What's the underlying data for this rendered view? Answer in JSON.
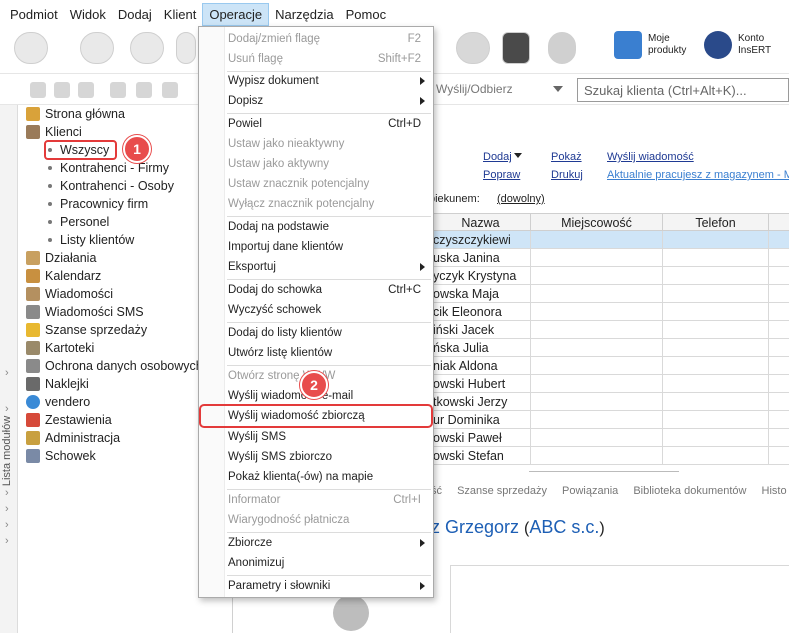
{
  "menubar": [
    "Podmiot",
    "Widok",
    "Dodaj",
    "Klient",
    "Operacje",
    "Narzędzia",
    "Pomoc"
  ],
  "toolbar": {
    "moje_produkty": [
      "Moje",
      "produkty"
    ],
    "konto": [
      "Konto",
      "InsERT"
    ]
  },
  "toolbar2": {
    "send_label": "Wyślij/Odbierz",
    "search_placeholder": "Szukaj klienta (Ctrl+Alt+K)..."
  },
  "sidebar": {
    "strip_label": "Lista modułów",
    "items": [
      {
        "label": "Strona główna"
      },
      {
        "label": "Klienci"
      },
      {
        "label": "Wszyscy"
      },
      {
        "label": "Kontrahenci - Firmy"
      },
      {
        "label": "Kontrahenci - Osoby"
      },
      {
        "label": "Pracownicy firm"
      },
      {
        "label": "Personel"
      },
      {
        "label": "Listy klientów"
      },
      {
        "label": "Działania"
      },
      {
        "label": "Kalendarz"
      },
      {
        "label": "Wiadomości"
      },
      {
        "label": "Wiadomości SMS"
      },
      {
        "label": "Szanse sprzedaży"
      },
      {
        "label": "Kartoteki"
      },
      {
        "label": "Ochrona danych osobowych"
      },
      {
        "label": "Naklejki"
      },
      {
        "label": "vendero"
      },
      {
        "label": "Zestawienia"
      },
      {
        "label": "Administracja"
      },
      {
        "label": "Schowek"
      }
    ],
    "colors": {
      "Strona główna": "#d9a23a",
      "Klienci": "#9a7b5a",
      "Działania": "#c8a060",
      "Kalendarz": "#c89040",
      "Wiadomości": "#b49060",
      "Wiadomości SMS": "#8a8a8a",
      "Szanse sprzedaży": "#e8b830",
      "Kartoteki": "#9a8a6a",
      "Ochrona danych osobowych": "#8a8a8a",
      "Naklejki": "#6a6a6a",
      "vendero": "#3a8ad6",
      "Zestawienia": "#d64a3a",
      "Administracja": "#c8a040",
      "Schowek": "#7a8aa6"
    }
  },
  "badges": [
    "1",
    "2"
  ],
  "content": {
    "links_row1": [
      "Dodaj",
      "Pokaż",
      "Wyślij wiadomość"
    ],
    "links_row2": [
      "Popraw",
      "Drukuj",
      "Aktualnie pracujesz z magazynem - MA"
    ],
    "filter_label": "piekunem:",
    "filter_value": "(dowolny)",
    "columns": [
      "Nazwa",
      "Miejscowość",
      "Telefon"
    ],
    "rows": [
      "czyszczykiewi",
      "uska Janina",
      "yczyk Krystyna",
      "owska Maja",
      "cik Eleonora",
      "iński Jacek",
      "ńska Julia",
      "niak Aldona",
      "owski Hubert",
      "tkowski Jerzy",
      "ur Dominika",
      "owski Paweł",
      "owski Stefan"
    ],
    "tabs": [
      "ść",
      "Szanse sprzedaży",
      "Powiązania",
      "Biblioteka dokumentów",
      "Histo"
    ],
    "client_name": "z Grzegorz",
    "client_company": "ABC s.c."
  },
  "dropdown": {
    "items": [
      {
        "label": "Dodaj/zmień flagę",
        "shortcut": "F2",
        "disabled": true
      },
      {
        "label": "Usuń flagę",
        "shortcut": "Shift+F2",
        "disabled": true
      },
      {
        "label": "Wypisz dokument",
        "shortcut": "",
        "submenu": true
      },
      {
        "label": "Dopisz",
        "shortcut": "",
        "submenu": true
      },
      {
        "label": "Powiel",
        "shortcut": "Ctrl+D"
      },
      {
        "label": "Ustaw jako nieaktywny",
        "shortcut": "",
        "disabled": true
      },
      {
        "label": "Ustaw jako aktywny",
        "shortcut": "",
        "disabled": true
      },
      {
        "label": "Ustaw znacznik potencjalny",
        "shortcut": "",
        "disabled": true
      },
      {
        "label": "Wyłącz znacznik potencjalny",
        "shortcut": "",
        "disabled": true
      },
      {
        "label": "Dodaj na podstawie",
        "shortcut": ""
      },
      {
        "label": "Importuj dane klientów",
        "shortcut": ""
      },
      {
        "label": "Eksportuj",
        "shortcut": "",
        "submenu": true
      },
      {
        "label": "Dodaj do schowka",
        "shortcut": "Ctrl+C"
      },
      {
        "label": "Wyczyść schowek",
        "shortcut": ""
      },
      {
        "label": "Dodaj do listy klientów",
        "shortcut": ""
      },
      {
        "label": "Utwórz listę klientów",
        "shortcut": ""
      },
      {
        "label": "Otwórz stronę WWW",
        "shortcut": "",
        "disabled": true
      },
      {
        "label": "Wyślij wiadomość e-mail",
        "shortcut": ""
      },
      {
        "label": "Wyślij wiadomość zbiorczą",
        "shortcut": ""
      },
      {
        "label": "Wyślij SMS",
        "shortcut": ""
      },
      {
        "label": "Wyślij SMS zbiorczo",
        "shortcut": ""
      },
      {
        "label": "Pokaż klienta(-ów) na mapie",
        "shortcut": ""
      },
      {
        "label": "Informator",
        "shortcut": "Ctrl+I",
        "disabled": true
      },
      {
        "label": "Wiarygodność płatnicza",
        "shortcut": "",
        "disabled": true
      },
      {
        "label": "Zbiorcze",
        "shortcut": "",
        "submenu": true
      },
      {
        "label": "Anonimizuj",
        "shortcut": ""
      },
      {
        "label": "Parametry i słowniki",
        "shortcut": "",
        "submenu": true
      }
    ]
  }
}
